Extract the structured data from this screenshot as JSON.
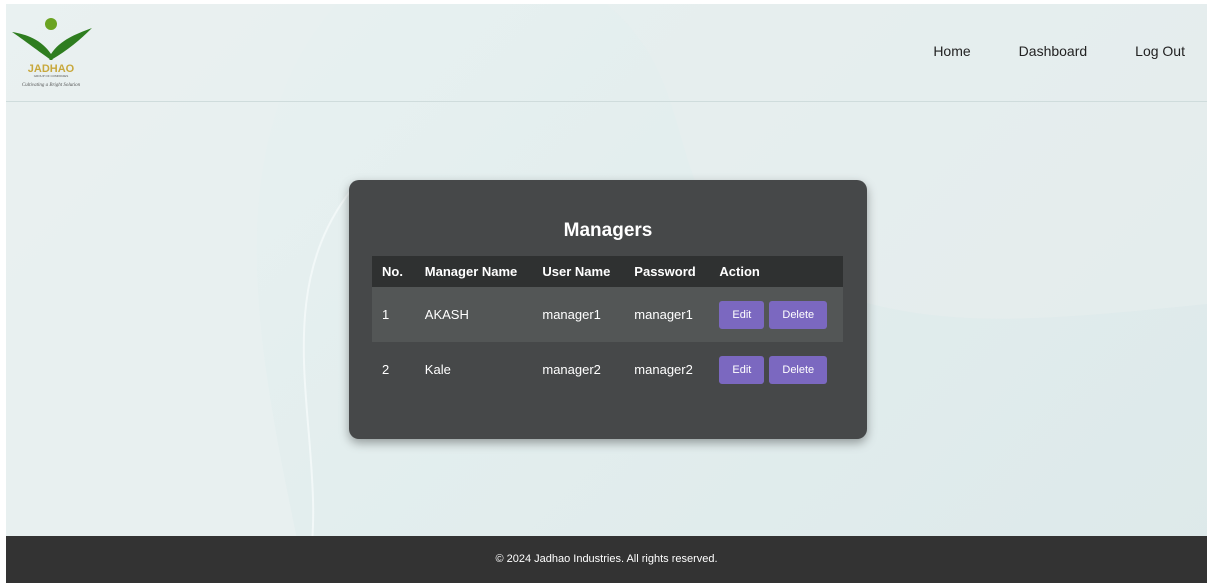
{
  "brand": {
    "logo_text": "JADHAO",
    "logo_sub": "GROUP OF COMPANIES",
    "logo_tagline": "Cultivating a Bright Solution"
  },
  "nav": {
    "home": "Home",
    "dashboard": "Dashboard",
    "logout": "Log Out"
  },
  "managers": {
    "title": "Managers",
    "columns": [
      "No.",
      "Manager Name",
      "User Name",
      "Password",
      "Action"
    ],
    "rows": [
      {
        "no": "1",
        "name": "AKASH",
        "username": "manager1",
        "password": "manager1"
      },
      {
        "no": "2",
        "name": "Kale",
        "username": "manager2",
        "password": "manager2"
      }
    ],
    "edit_label": "Edit",
    "delete_label": "Delete"
  },
  "footer": {
    "text": "© 2024 Jadhao Industries. All rights reserved."
  },
  "colors": {
    "accent": "#7b68c0",
    "card": "#464849",
    "footer": "#333333"
  }
}
